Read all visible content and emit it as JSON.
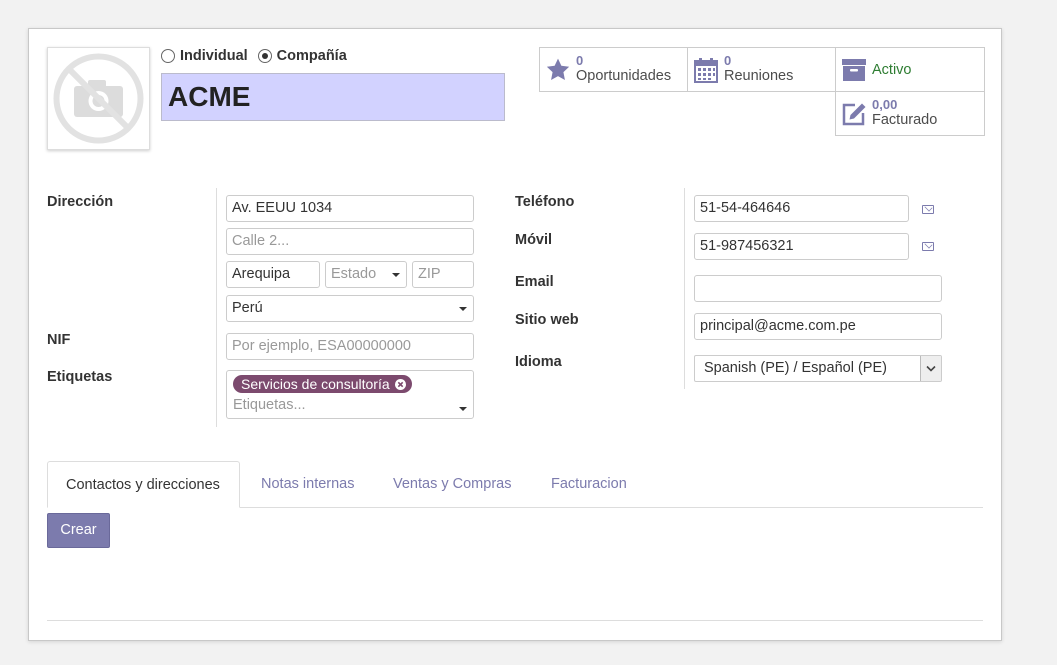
{
  "partner": {
    "type_options": [
      {
        "label": "Individual",
        "selected": false
      },
      {
        "label": "Compañía",
        "selected": true
      }
    ],
    "name": "ACME"
  },
  "smart_buttons": {
    "opportunities": {
      "value": "0",
      "label": "Oportunidades",
      "icon": "star-icon"
    },
    "meetings": {
      "value": "0",
      "label": "Reuniones",
      "icon": "calendar-icon"
    },
    "active": {
      "label": "Activo",
      "icon": "archive-icon",
      "color": "#2e7d32"
    },
    "invoiced": {
      "value": "0,00",
      "label": "Facturado",
      "icon": "edit-icon"
    }
  },
  "address": {
    "label": "Dirección",
    "street": "Av. EEUU 1034",
    "street2_placeholder": "Calle 2...",
    "city": "Arequipa",
    "state_placeholder": "Estado",
    "zip_placeholder": "ZIP",
    "country": "Perú"
  },
  "nif": {
    "label": "NIF",
    "placeholder": "Por ejemplo, ESA00000000"
  },
  "tags": {
    "label": "Etiquetas",
    "tag": "Servicios de consultoría",
    "placeholder": "Etiquetas..."
  },
  "contact": {
    "phone_label": "Teléfono",
    "phone": "51-54-464646",
    "mobile_label": "Móvil",
    "mobile": "51-987456321",
    "email_label": "Email",
    "email": "",
    "website_label": "Sitio web",
    "website": "principal@acme.com.pe",
    "language_label": "Idioma",
    "language": "Spanish (PE) / Español (PE)"
  },
  "tabs": [
    {
      "label": "Contactos y direcciones",
      "active": true
    },
    {
      "label": "Notas internas",
      "active": false
    },
    {
      "label": "Ventas y Compras",
      "active": false
    },
    {
      "label": "Facturacion",
      "active": false
    }
  ],
  "create_button": "Crear",
  "colors": {
    "accent": "#7c7bad",
    "name_bg": "#d2d2ff",
    "tag_bg": "#7c4a6e"
  }
}
